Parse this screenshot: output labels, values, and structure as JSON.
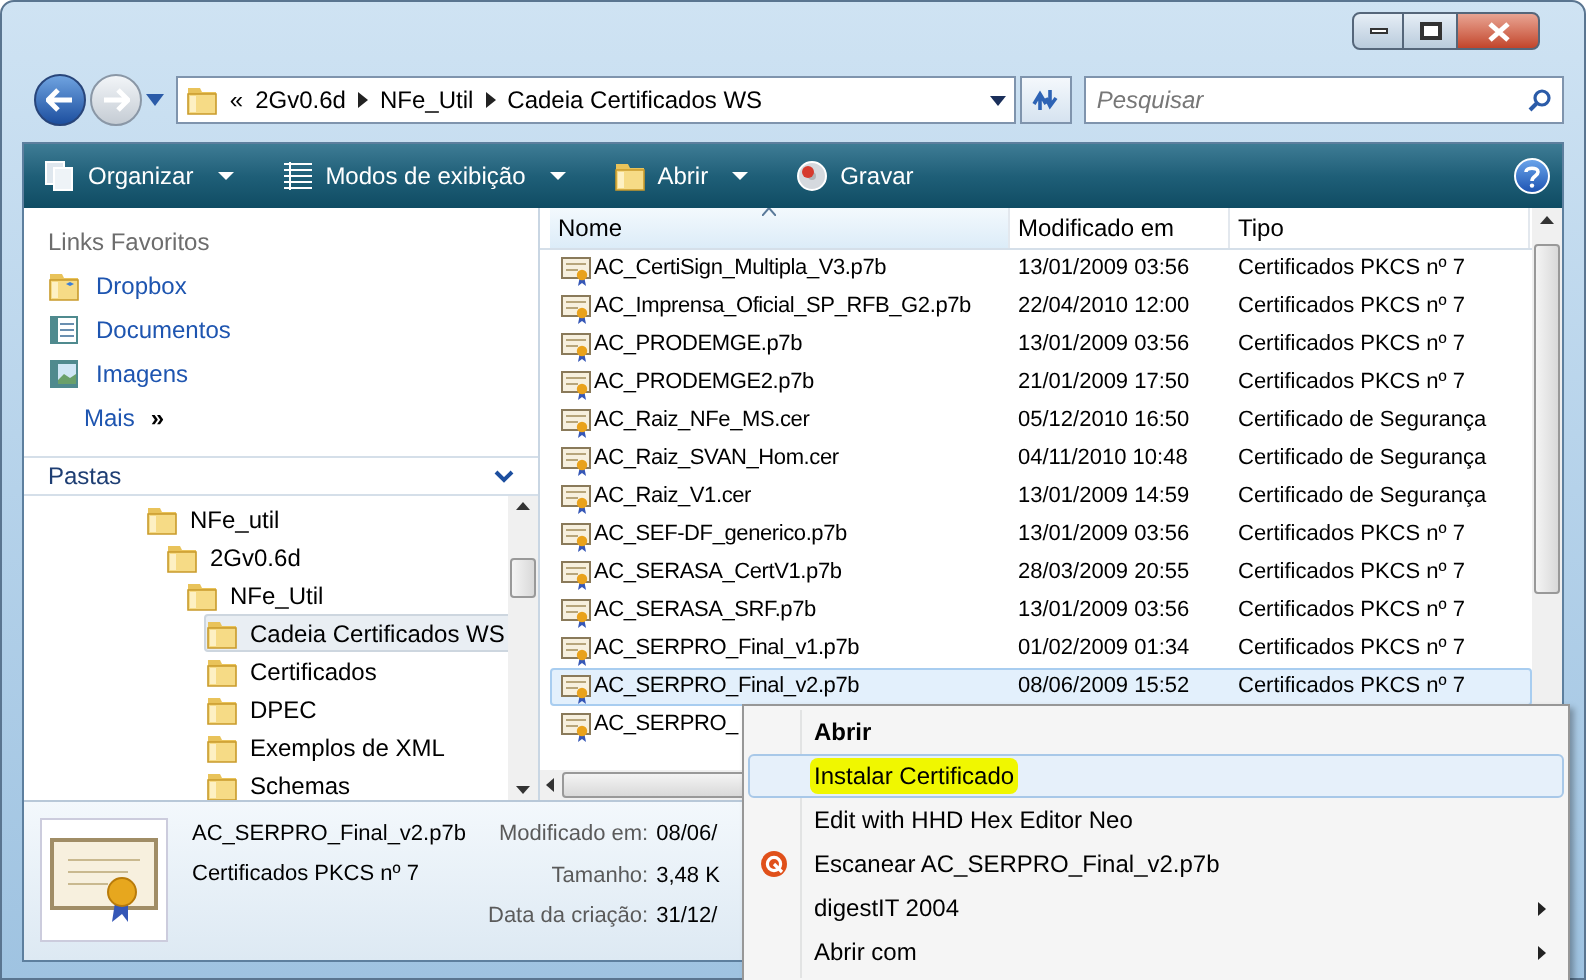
{
  "address": {
    "overflow": "«",
    "segments": [
      "2Gv0.6d",
      "NFe_Util",
      "Cadeia Certificados WS"
    ]
  },
  "search": {
    "placeholder": "Pesquisar"
  },
  "toolbar": [
    {
      "label": "Organizar",
      "kind": "organize",
      "dropdown": true
    },
    {
      "label": "Modos de exibição",
      "kind": "views",
      "dropdown": true
    },
    {
      "label": "Abrir",
      "kind": "folder",
      "dropdown": true
    },
    {
      "label": "Gravar",
      "kind": "burn",
      "dropdown": false
    }
  ],
  "favorites": {
    "title": "Links Favoritos",
    "items": [
      {
        "label": "Dropbox",
        "kind": "dropbox"
      },
      {
        "label": "Documentos",
        "kind": "documents"
      },
      {
        "label": "Imagens",
        "kind": "pictures"
      }
    ],
    "more": {
      "label": "Mais",
      "glyph": "»"
    }
  },
  "folders": {
    "title": "Pastas",
    "tree": [
      {
        "label": "NFe_util",
        "selected": false,
        "children": [
          {
            "label": "2Gv0.6d",
            "selected": false,
            "children": [
              {
                "label": "NFe_Util",
                "selected": false,
                "children": [
                  {
                    "label": "Cadeia Certificados WS",
                    "selected": true
                  },
                  {
                    "label": "Certificados",
                    "selected": false
                  },
                  {
                    "label": "DPEC",
                    "selected": false
                  },
                  {
                    "label": "Exemplos de XML",
                    "selected": false
                  },
                  {
                    "label": "Schemas",
                    "selected": false
                  }
                ]
              }
            ]
          }
        ]
      }
    ]
  },
  "table": {
    "columns": [
      "Nome",
      "Modificado em",
      "Tipo"
    ],
    "rows": [
      {
        "name": "AC_CertiSign_Multipla_V3.p7b",
        "modified": "13/01/2009 03:56",
        "type": "Certificados PKCS nº 7",
        "selected": false
      },
      {
        "name": "AC_Imprensa_Oficial_SP_RFB_G2.p7b",
        "modified": "22/04/2010 12:00",
        "type": "Certificados PKCS nº 7",
        "selected": false
      },
      {
        "name": "AC_PRODEMGE.p7b",
        "modified": "13/01/2009 03:56",
        "type": "Certificados PKCS nº 7",
        "selected": false
      },
      {
        "name": "AC_PRODEMGE2.p7b",
        "modified": "21/01/2009 17:50",
        "type": "Certificados PKCS nº 7",
        "selected": false
      },
      {
        "name": "AC_Raiz_NFe_MS.cer",
        "modified": "05/12/2010 16:50",
        "type": "Certificado de Segurança",
        "selected": false
      },
      {
        "name": "AC_Raiz_SVAN_Hom.cer",
        "modified": "04/11/2010 10:48",
        "type": "Certificado de Segurança",
        "selected": false
      },
      {
        "name": "AC_Raiz_V1.cer",
        "modified": "13/01/2009 14:59",
        "type": "Certificado de Segurança",
        "selected": false
      },
      {
        "name": "AC_SEF-DF_generico.p7b",
        "modified": "13/01/2009 03:56",
        "type": "Certificados PKCS nº 7",
        "selected": false
      },
      {
        "name": "AC_SERASA_CertV1.p7b",
        "modified": "28/03/2009 20:55",
        "type": "Certificados PKCS nº 7",
        "selected": false
      },
      {
        "name": "AC_SERASA_SRF.p7b",
        "modified": "13/01/2009 03:56",
        "type": "Certificados PKCS nº 7",
        "selected": false
      },
      {
        "name": "AC_SERPRO_Final_v1.p7b",
        "modified": "01/02/2009 01:34",
        "type": "Certificados PKCS nº 7",
        "selected": false
      },
      {
        "name": "AC_SERPRO_Final_v2.p7b",
        "modified": "08/06/2009 15:52",
        "type": "Certificados PKCS nº 7",
        "selected": true
      },
      {
        "name": "AC_SERPRO_",
        "selected": false
      }
    ]
  },
  "details": {
    "name": "AC_SERPRO_Final_v2.p7b",
    "type": "Certificados PKCS nº 7",
    "fields": [
      {
        "label": "Modificado em:",
        "value": "08/06/"
      },
      {
        "label": "Tamanho:",
        "value": "3,48 K"
      },
      {
        "label": "Data da criação:",
        "value": "31/12/"
      }
    ]
  },
  "context_menu": [
    {
      "label": "Abrir",
      "kind": "plain",
      "default": true,
      "selected": false,
      "submenu": false
    },
    {
      "label": "Instalar Certificado",
      "kind": "plain",
      "default": false,
      "selected": true,
      "submenu": false
    },
    {
      "label": "Edit with HHD Hex Editor Neo",
      "kind": "plain",
      "default": false,
      "selected": false,
      "submenu": false
    },
    {
      "label": "Escanear AC_SERPRO_Final_v2.p7b",
      "kind": "scan",
      "default": false,
      "selected": false,
      "submenu": false
    },
    {
      "label": "digestIT 2004",
      "kind": "plain",
      "default": false,
      "selected": false,
      "submenu": true
    },
    {
      "label": "Abrir com",
      "kind": "plain",
      "default": false,
      "selected": false,
      "submenu": true
    }
  ]
}
